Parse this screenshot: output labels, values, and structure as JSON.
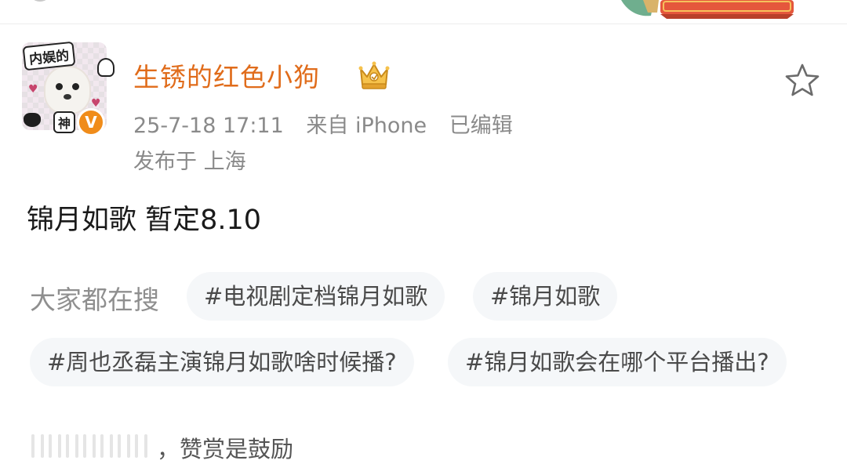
{
  "author": {
    "name": "生锈的红色小狗",
    "avatar_tag_top": "内娱的",
    "avatar_tag_bottom": "神",
    "verified_mark": "V"
  },
  "meta": {
    "time": "25-7-18 17:11",
    "source": "来自 iPhone",
    "edited": "已编辑",
    "location": "发布于 上海"
  },
  "post": {
    "text": "锦月如歌 暂定8.10"
  },
  "search": {
    "label": "大家都在搜",
    "chips": [
      "#电视剧定档锦月如歌",
      "#锦月如歌",
      "#周也丞磊主演锦月如歌啥时候播?",
      "#锦月如歌会在哪个平台播出?"
    ]
  },
  "reward": {
    "text": "，赞赏是鼓励"
  },
  "colors": {
    "username": "#e06c1b",
    "meta_gray": "#8a8a8a",
    "chip_bg": "#f5f7f9",
    "verified": "#f08c1a"
  },
  "icons": {
    "favorite": "star-outline-icon",
    "badge": "crown-icon",
    "verified": "verified-v-icon"
  }
}
